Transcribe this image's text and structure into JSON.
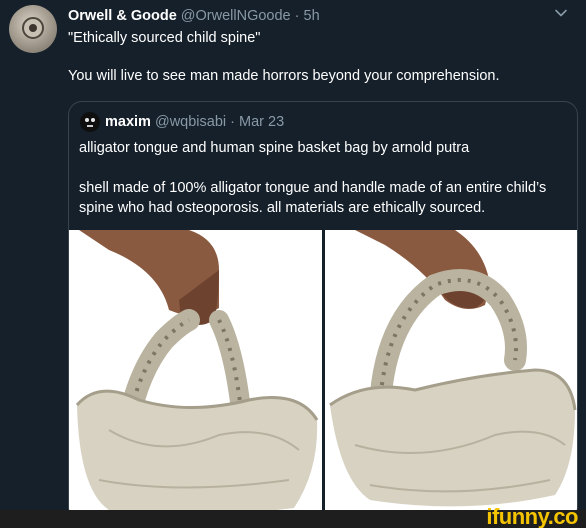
{
  "tweet": {
    "display_name": "Orwell & Goode",
    "handle": "@OrwellNGoode",
    "separator": "·",
    "time": "5h",
    "text_line1": "\"Ethically sourced child spine\"",
    "text_line2": "You will live to see man made horrors beyond your comprehension.",
    "menu_icon": "chevron-down-icon"
  },
  "quote": {
    "display_name": "maxim",
    "handle": "@wqbisabi",
    "separator": "·",
    "date": "Mar 23",
    "text_line1": "alligator tongue and human spine basket bag by arnold putra",
    "text_line2": "shell made of 100% alligator tongue and handle made of an entire child’s spine who had osteoporosis. all materials are ethically sourced."
  },
  "watermark": {
    "text": "ifunny.co"
  }
}
